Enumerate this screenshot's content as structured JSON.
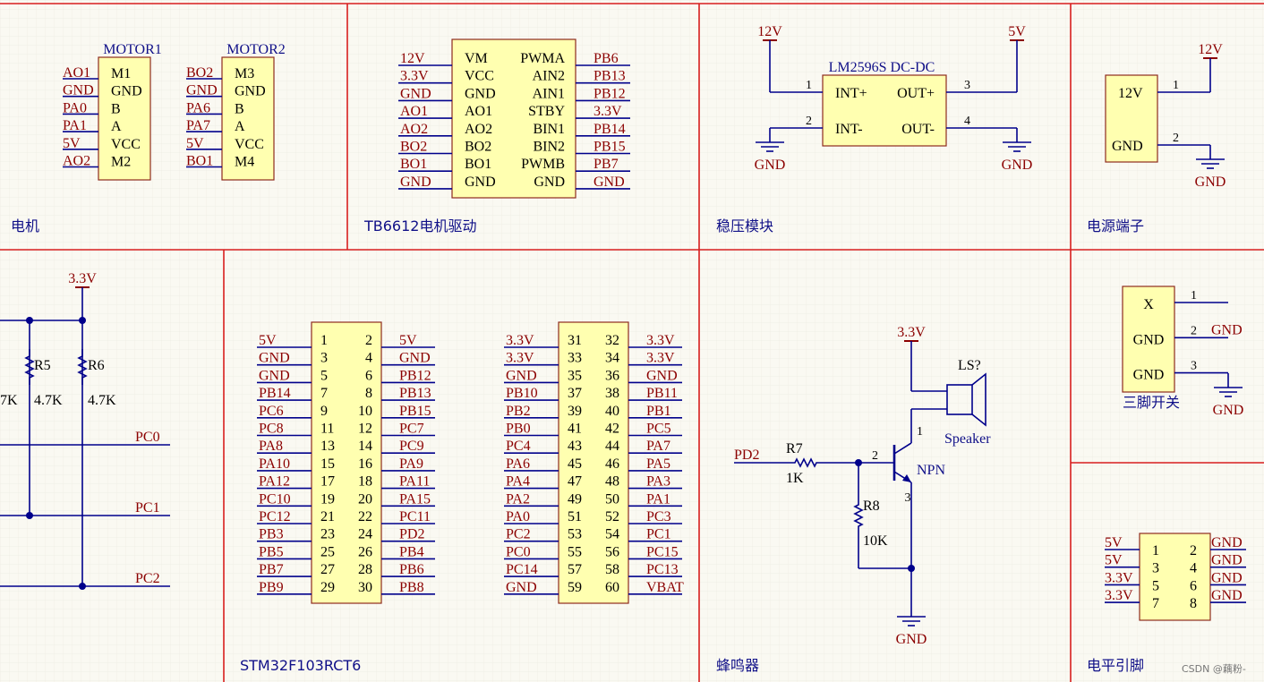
{
  "colors": {
    "bg": "#FAF9F2",
    "grid": "#ECEBE3",
    "frame": "#D81E1E",
    "wire": "#00008B",
    "body": "#FFFFB0",
    "body_border": "#8E2B1E",
    "net": "#8B0000",
    "text": "#000000",
    "blue_text": "#101088",
    "pin_line": "#00008B"
  },
  "sections": {
    "motor": "电机",
    "tb6612": "TB6612电机驱动",
    "regulator": "稳压模块",
    "power_terminal": "电源端子",
    "stm32": "STM32F103RCT6",
    "buzzer": "蜂鸣器",
    "switch3": "三脚开关",
    "level_pins": "电平引脚"
  },
  "watermark": "CSDN @藕粉-",
  "motor1": {
    "title": "MOTOR1",
    "nets": [
      "AO1",
      "GND",
      "PA0",
      "PA1",
      "5V",
      "AO2"
    ],
    "pins": [
      "M1",
      "GND",
      "B",
      "A",
      "VCC",
      "M2"
    ]
  },
  "motor2": {
    "title": "MOTOR2",
    "nets": [
      "BO2",
      "GND",
      "PA6",
      "PA7",
      "5V",
      "BO1"
    ],
    "pins": [
      "M3",
      "GND",
      "B",
      "A",
      "VCC",
      "M4"
    ]
  },
  "tb6612": {
    "left_nets": [
      "12V",
      "3.3V",
      "GND",
      "AO1",
      "AO2",
      "BO2",
      "BO1",
      "GND"
    ],
    "left_pins": [
      "VM",
      "VCC",
      "GND",
      "AO1",
      "AO2",
      "BO2",
      "BO1",
      "GND"
    ],
    "right_pins": [
      "PWMA",
      "AIN2",
      "AIN1",
      "STBY",
      "BIN1",
      "BIN2",
      "PWMB",
      "GND"
    ],
    "right_nets": [
      "PB6",
      "PB13",
      "PB12",
      "3.3V",
      "PB14",
      "PB15",
      "PB7",
      "GND"
    ]
  },
  "regulator": {
    "title": "LM2596S DC-DC",
    "in_pins": [
      "INT+",
      "INT-"
    ],
    "out_pins": [
      "OUT+",
      "OUT-"
    ],
    "pin_nums": [
      "1",
      "2",
      "3",
      "4"
    ],
    "in_power": "12V",
    "out_power": "5V",
    "gnd": "GND"
  },
  "power_terminal": {
    "pins": [
      "12V",
      "GND"
    ],
    "nums": [
      "1",
      "2"
    ],
    "power": "12V",
    "gnd": "GND"
  },
  "pullups": {
    "power": "3.3V",
    "r5": {
      "name": "R5",
      "value": "4.7K"
    },
    "r6": {
      "name": "R6",
      "value": "4.7K"
    },
    "partial_value": "7K",
    "nets": [
      "PC0",
      "PC1",
      "PC2"
    ]
  },
  "stm32_header1": {
    "rows": [
      [
        "5V",
        "1",
        "2",
        "5V"
      ],
      [
        "GND",
        "3",
        "4",
        "GND"
      ],
      [
        "GND",
        "5",
        "6",
        "PB12"
      ],
      [
        "PB14",
        "7",
        "8",
        "PB13"
      ],
      [
        "PC6",
        "9",
        "10",
        "PB15"
      ],
      [
        "PC8",
        "11",
        "12",
        "PC7"
      ],
      [
        "PA8",
        "13",
        "14",
        "PC9"
      ],
      [
        "PA10",
        "15",
        "16",
        "PA9"
      ],
      [
        "PA12",
        "17",
        "18",
        "PA11"
      ],
      [
        "PC10",
        "19",
        "20",
        "PA15"
      ],
      [
        "PC12",
        "21",
        "22",
        "PC11"
      ],
      [
        "PB3",
        "23",
        "24",
        "PD2"
      ],
      [
        "PB5",
        "25",
        "26",
        "PB4"
      ],
      [
        "PB7",
        "27",
        "28",
        "PB6"
      ],
      [
        "PB9",
        "29",
        "30",
        "PB8"
      ]
    ]
  },
  "stm32_header2": {
    "rows": [
      [
        "3.3V",
        "31",
        "32",
        "3.3V"
      ],
      [
        "3.3V",
        "33",
        "34",
        "3.3V"
      ],
      [
        "GND",
        "35",
        "36",
        "GND"
      ],
      [
        "PB10",
        "37",
        "38",
        "PB11"
      ],
      [
        "PB2",
        "39",
        "40",
        "PB1"
      ],
      [
        "PB0",
        "41",
        "42",
        "PC5"
      ],
      [
        "PC4",
        "43",
        "44",
        "PA7"
      ],
      [
        "PA6",
        "45",
        "46",
        "PA5"
      ],
      [
        "PA4",
        "47",
        "48",
        "PA3"
      ],
      [
        "PA2",
        "49",
        "50",
        "PA1"
      ],
      [
        "PA0",
        "51",
        "52",
        "PC3"
      ],
      [
        "PC2",
        "53",
        "54",
        "PC1"
      ],
      [
        "PC0",
        "55",
        "56",
        "PC15"
      ],
      [
        "PC14",
        "57",
        "58",
        "PC13"
      ],
      [
        "GND",
        "59",
        "60",
        "VBAT"
      ]
    ]
  },
  "buzzer": {
    "power": "3.3V",
    "speaker_ref": "LS?",
    "speaker_name": "Speaker",
    "transistor": "NPN",
    "input_net": "PD2",
    "r7": {
      "name": "R7",
      "value": "1K"
    },
    "r8": {
      "name": "R8",
      "value": "10K"
    },
    "gnd": "GND",
    "pin_nums": [
      "1",
      "2",
      "3"
    ]
  },
  "switch3": {
    "pins": [
      "X",
      "GND",
      "GND"
    ],
    "nums": [
      "1",
      "2",
      "3"
    ],
    "nets": [
      "",
      "GND",
      ""
    ],
    "gnd": "GND"
  },
  "level_header": {
    "left_nets": [
      "5V",
      "5V",
      "3.3V",
      "3.3V"
    ],
    "left_nums": [
      "1",
      "3",
      "5",
      "7"
    ],
    "right_nums": [
      "2",
      "4",
      "6",
      "8"
    ],
    "right_nets": [
      "GND",
      "GND",
      "GND",
      "GND"
    ]
  }
}
